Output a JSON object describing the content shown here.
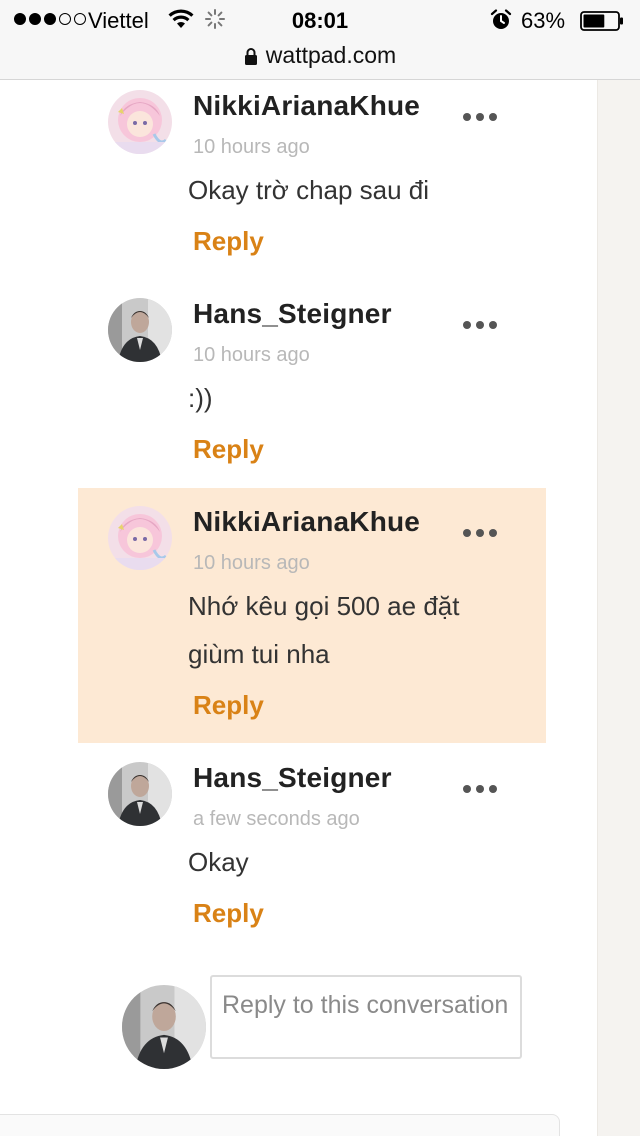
{
  "status_bar": {
    "carrier": "Viettel",
    "time": "08:01",
    "battery_percent": "63%",
    "battery_level": 0.63,
    "signal_bars_filled": 3,
    "signal_bars_total": 5
  },
  "browser": {
    "url": "wattpad.com"
  },
  "comments": [
    {
      "username": "NikkiArianaKhue",
      "time": "10 hours ago",
      "lines": [
        "Okay trờ chap sau đi"
      ],
      "reply_label": "Reply",
      "highlighted": false,
      "avatar": "anime-girl-avatar"
    },
    {
      "username": "Hans_Steigner",
      "time": "10 hours ago",
      "lines": [
        ":))"
      ],
      "reply_label": "Reply",
      "highlighted": false,
      "avatar": "man-photo-avatar"
    },
    {
      "username": "NikkiArianaKhue",
      "time": "10 hours ago",
      "lines": [
        "Nhớ kêu gọi 500 ae đặt",
        "giùm tui nha"
      ],
      "reply_label": "Reply",
      "highlighted": true,
      "avatar": "anime-girl-avatar"
    },
    {
      "username": "Hans_Steigner",
      "time": "a few seconds ago",
      "lines": [
        "Okay"
      ],
      "reply_label": "Reply",
      "highlighted": false,
      "avatar": "man-photo-avatar"
    }
  ],
  "reply_box": {
    "placeholder": "Reply to this conversation"
  },
  "colors": {
    "reply_accent": "#d98216",
    "highlight_bg": "#fde9d4",
    "timestamp": "#b8b8b8"
  }
}
